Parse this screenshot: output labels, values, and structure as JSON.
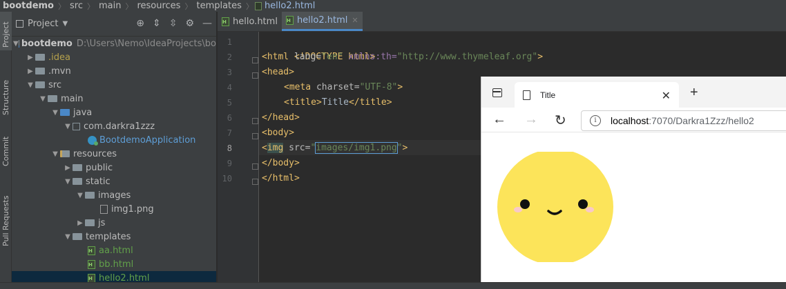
{
  "breadcrumb": {
    "items": [
      "bootdemo",
      "src",
      "main",
      "resources",
      "templates",
      "hello2.html"
    ]
  },
  "tool_strip": {
    "tabs": [
      "Project",
      "Structure",
      "Commit",
      "Pull Requests"
    ]
  },
  "project_panel": {
    "title": "Project",
    "tree": [
      {
        "label": "bootdemo",
        "path": "D:\\Users\\Nemo\\IdeaProjects\\bo"
      },
      {
        "label": ".idea"
      },
      {
        "label": ".mvn"
      },
      {
        "label": "src"
      },
      {
        "label": "main"
      },
      {
        "label": "java"
      },
      {
        "label": "com.darkra1zzz"
      },
      {
        "label": "BootdemoApplication"
      },
      {
        "label": "resources"
      },
      {
        "label": "public"
      },
      {
        "label": "static"
      },
      {
        "label": "images"
      },
      {
        "label": "img1.png"
      },
      {
        "label": "js"
      },
      {
        "label": "templates"
      },
      {
        "label": "aa.html"
      },
      {
        "label": "bb.html"
      },
      {
        "label": "hello2.html"
      }
    ]
  },
  "editor": {
    "tabs": [
      {
        "label": "hello.html",
        "active": false
      },
      {
        "label": "hello2.html",
        "active": true
      }
    ],
    "line_numbers": [
      "1",
      "2",
      "3",
      "4",
      "5",
      "6",
      "7",
      "8",
      "9",
      "10"
    ],
    "current_line": "8",
    "code": {
      "l1": "<!DOCTYPE html>",
      "l2_open": "<html",
      "l2_attr1": " lang=",
      "l2_val1": "\"en\"",
      "l2_attr2": " xmlns:th=",
      "l2_val2": "\"http://www.thymeleaf.org\"",
      "l2_close": ">",
      "l3": "<head>",
      "l4_open": "<meta",
      "l4_attr": " charset=",
      "l4_val": "\"UTF-8\"",
      "l4_close": ">",
      "l5_open": "<title>",
      "l5_text": "Title",
      "l5_close": "</title>",
      "l6": "</head>",
      "l7": "<body>",
      "l8_lt": "<",
      "l8_tag": "img",
      "l8_attr": " src=",
      "l8_q1": "\"",
      "l8_val": "images/img1.png",
      "l8_q2": "\"",
      "l8_close": ">",
      "l9": "</body>",
      "l10": "</html>"
    }
  },
  "browser": {
    "tab_title": "Title",
    "url_host": "localhost",
    "url_path": ":7070/Darkra1Zzz/hello2"
  },
  "colors": {
    "ide_bg": "#2b2b2b",
    "panel_bg": "#3c3f41",
    "tag": "#e8bf6a",
    "string": "#6a8759",
    "smiley_face": "#fce45a",
    "smiley_blush": "#f9c9c9"
  }
}
